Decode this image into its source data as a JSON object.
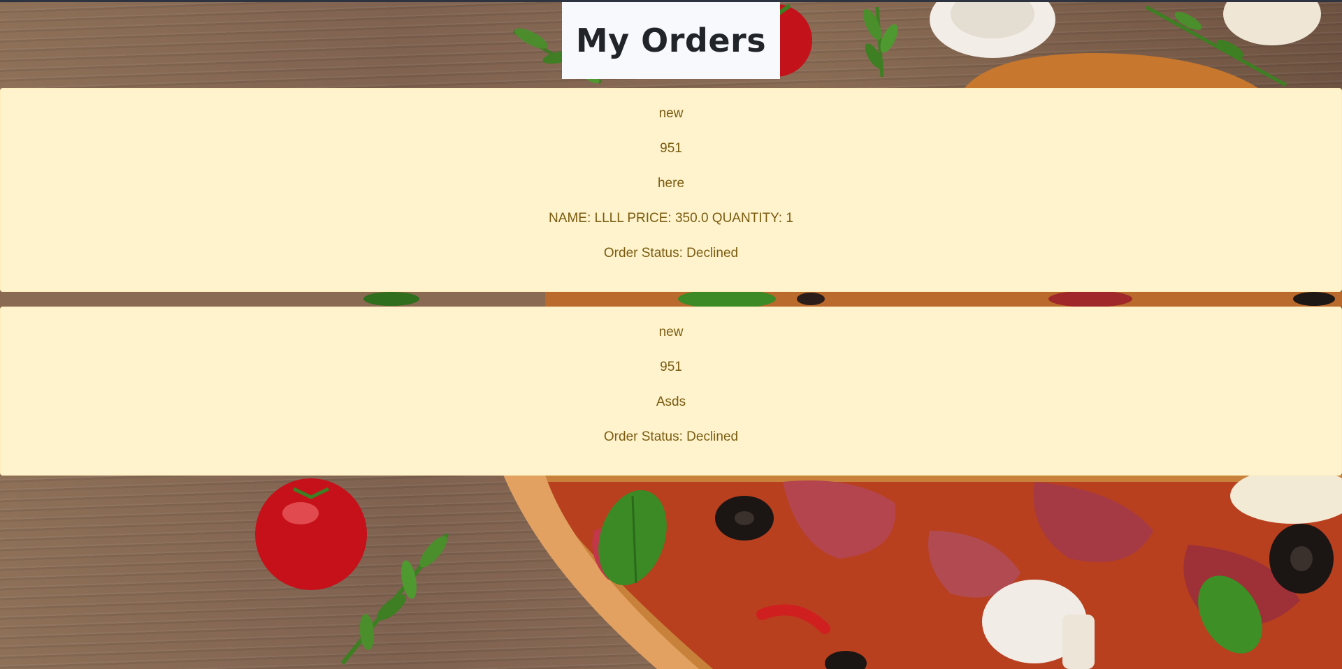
{
  "page": {
    "title": "My Orders"
  },
  "orders": [
    {
      "lines": [
        "new",
        "951",
        "here",
        "NAME: LLLL PRICE: 350.0 QUANTITY: 1",
        "Order Status: Declined"
      ]
    },
    {
      "lines": [
        "new",
        "951",
        "Asds",
        "Order Status: Declined"
      ]
    }
  ],
  "colors": {
    "card_background": "#fff3cd",
    "card_text": "#856404",
    "title_background": "#f8f9fd",
    "title_text": "#212529"
  }
}
